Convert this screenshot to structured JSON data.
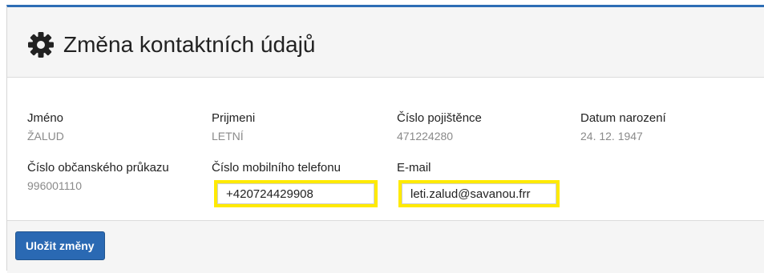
{
  "header": {
    "title": "Změna kontaktních údajů",
    "icon": "gear-icon"
  },
  "fields": {
    "first_name": {
      "label": "Jméno",
      "value": "ŽALUD"
    },
    "last_name": {
      "label": "Prijmeni",
      "value": "LETNÍ"
    },
    "insurance_number": {
      "label": "Číslo pojištěnce",
      "value": "471224280"
    },
    "birth_date": {
      "label": "Datum narození",
      "value": "24. 12. 1947"
    },
    "id_card_number": {
      "label": "Číslo občanského průkazu",
      "value": "996001110"
    },
    "mobile_phone": {
      "label": "Číslo mobilního telefonu",
      "value": "+420724429908"
    },
    "email": {
      "label": "E-mail",
      "value": "leti.zalud@savanou.frr"
    }
  },
  "footer": {
    "save_label": "Uložit změny"
  },
  "colors": {
    "accent": "#2d6db5",
    "button": "#2a69b3",
    "highlight": "#ffea00",
    "muted_text": "#8a8a8a"
  }
}
